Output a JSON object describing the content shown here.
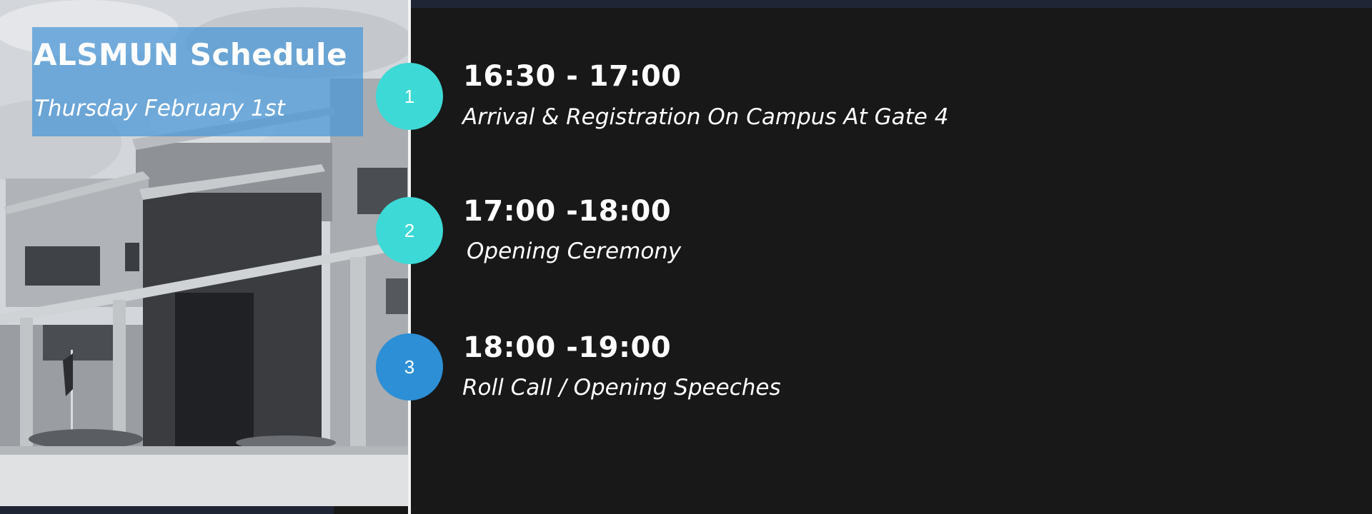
{
  "header": {
    "title": "ALSMUN Schedule",
    "subtitle": "Thursday February 1st"
  },
  "colors": {
    "background": "#181818",
    "navy": "#1f2535",
    "teal": "#3dd9d6",
    "blue": "#2d8fd5",
    "title_box": "#4696d7"
  },
  "schedule": [
    {
      "number": "1",
      "time": "16:30 - 17:00",
      "description": "Arrival & Registration On Campus At Gate 4",
      "color": "#3dd9d6"
    },
    {
      "number": "2",
      "time": "17:00 -18:00",
      "description": "Opening Ceremony",
      "color": "#3dd9d6"
    },
    {
      "number": "3",
      "time": "18:00 -19:00",
      "description": "Roll Call / Opening Speeches",
      "color": "#2d8fd5"
    }
  ]
}
